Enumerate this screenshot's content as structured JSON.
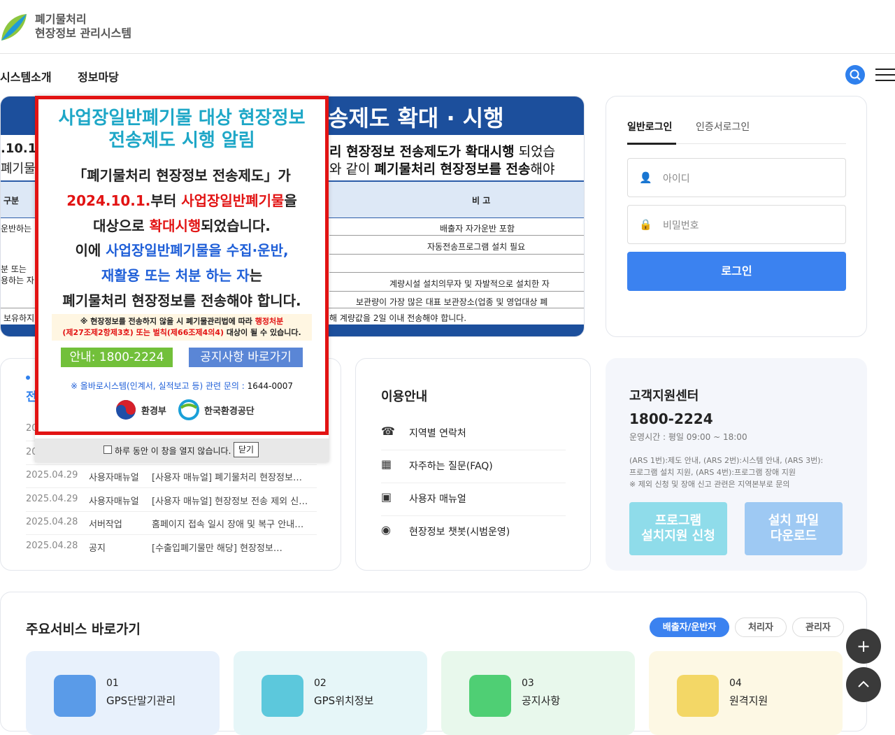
{
  "header": {
    "logo_line1": "폐기물처리",
    "logo_line2": "현장정보 관리시스템"
  },
  "nav": {
    "items": [
      "시스템소개",
      "정보마당"
    ]
  },
  "banner": {
    "title": "송제도 확대 · 시행",
    "left_frag1": ".10.1",
    "left_frag2": "폐기물",
    "line1_bold": "리 현장정보 전송제도가 확대시행",
    "line1_rest": " 되었습",
    "line2_a": "와 같이 ",
    "line2_bold": "폐기물처리 현장정보를 전송",
    "line2_rest": "해야",
    "table": {
      "head_left": "구분",
      "head_right": "비 고",
      "rows_left": [
        "운반하는",
        "분 또는",
        "용하는 자",
        "보유하지"
      ],
      "rows_right": [
        "배출자 자가운반 포함",
        "자동전송프로그램 설치 필요",
        "계량시설 설치의무자 및 자발적으로 설치한 자",
        "보관량이 가장 많은 대표 보관장소(업종 및 영업대상 폐",
        "해 계량값을 2일 이내 전송해야 합니다."
      ]
    }
  },
  "login": {
    "tab_general": "일반로그인",
    "tab_cert": "인증서로그인",
    "id_placeholder": "아이디",
    "pw_placeholder": "비밀번호",
    "login_button": "로그인"
  },
  "notices": {
    "rows": [
      {
        "date": "20",
        "cat": "",
        "title": ""
      },
      {
        "date": "20",
        "cat": "",
        "title": ""
      },
      {
        "date": "2025.04.29",
        "cat": "사용자매뉴얼",
        "title": "[사용자 매뉴얼] 폐기물처리 현장정보…"
      },
      {
        "date": "2025.04.29",
        "cat": "사용자매뉴얼",
        "title": "[사용자 매뉴얼] 현장정보 전송 제외 신…"
      },
      {
        "date": "2025.04.28",
        "cat": "서버작업",
        "title": "홈페이지 접속 일시 장애 및 복구 안내…"
      },
      {
        "date": "2025.04.28",
        "cat": "공지",
        "title": "[수출입폐기물만 해당] 현장정보…"
      }
    ],
    "tab_frag": "전"
  },
  "guide": {
    "title": "이용안내",
    "items": [
      {
        "label": "지역별 연락처",
        "icon": "phone-icon"
      },
      {
        "label": "자주하는 질문(FAQ)",
        "icon": "faq-icon"
      },
      {
        "label": "사용자 매뉴얼",
        "icon": "manual-icon"
      },
      {
        "label": "현장정보 챗봇(시범운영)",
        "icon": "chatbot-icon"
      }
    ]
  },
  "support": {
    "title": "고객지원센터",
    "phone": "1800-2224",
    "hours": "운영시간 : 평일 09:00 ~ 18:00",
    "note1": "(ARS 1번):제도 안내, (ARS 2번):시스템 안내, (ARS 3번):",
    "note2": "프로그램 설치 지원, (ARS 4번):프로그램 장애 지원",
    "note3": "※ 제외 신청 및 장애 신고 관련은 지역본부로 문의",
    "btn_program_1": "프로그램",
    "btn_program_2": "설치지원 신청",
    "btn_download_1": "설치 파일",
    "btn_download_2": "다운로드"
  },
  "services": {
    "title": "주요서비스 바로가기",
    "tabs": [
      "배출자/운반자",
      "처리자",
      "관리자"
    ],
    "tiles": [
      {
        "num": "01",
        "label": "GPS단말기관리"
      },
      {
        "num": "02",
        "label": "GPS위치정보"
      },
      {
        "num": "03",
        "label": "공지사항"
      },
      {
        "num": "04",
        "label": "원격지원"
      }
    ]
  },
  "popup": {
    "title1": "사업장일반폐기물 대상 현장정보",
    "title2": "전송제도 시행 알림",
    "l1": "「폐기물처리 현장정보 전송제도」가",
    "l2_red1": "2024.10.1.",
    "l2_mid": "부터 ",
    "l2_red2": "사업장일반폐기물",
    "l2_end": "을",
    "l3_a": "대상으로 ",
    "l3_red": "확대시행",
    "l3_b": "되었습니다.",
    "l4_a": "이에 ",
    "l4_blue": "사업장일반폐기물을 수집·운반,",
    "l5_blue": "재활용 또는 처분 하는 자",
    "l5_b": "는",
    "l6": "폐기물처리 현장정보를 전송해야 합니다.",
    "warn_a": "※ 현장정보를 전송하지 않을 시 폐기물관리법에 따라 ",
    "warn_red1": "행정처분",
    "warn_red2": "(제27조제2항제3호) 또는 벌칙",
    "warn_red3": "(제66조제4의4)",
    "warn_end": " 대상이 될 수 있습니다.",
    "btn_guide": "안내: 1800-2224",
    "btn_notice": "공지사항 바로가기",
    "inquiry_a": "※ 올바로시스템(인계서, 실적보고 등) 관련 문의 : ",
    "inquiry_b": "1644-0007",
    "logo1": "환경부",
    "logo2": "한국환경공단",
    "dont_show": "하루 동안 이 창을 열지 않습니다.",
    "close": "닫기"
  },
  "colors": {
    "primary": "#3b82f0",
    "banner_navy": "#1c4f9c",
    "popup_red": "#e21313"
  }
}
